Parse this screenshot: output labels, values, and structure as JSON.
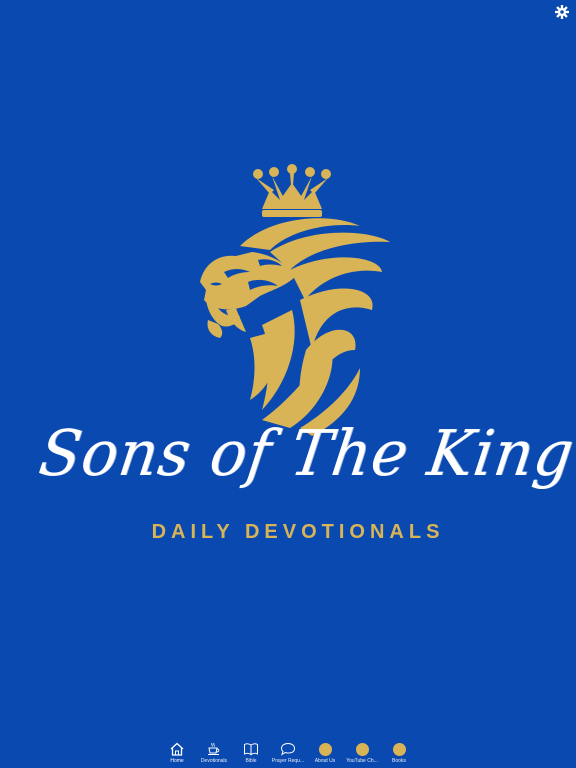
{
  "colors": {
    "background": "#0a4ab0",
    "gold": "#d8b456",
    "white": "#ffffff"
  },
  "header": {
    "settings_icon": "gear-icon"
  },
  "brand": {
    "title": "Sons of The King",
    "subtitle": "DAILY DEVOTIONALS"
  },
  "tabbar": {
    "tabs": [
      {
        "label": "Home",
        "icon": "home-icon",
        "active": true
      },
      {
        "label": "Devotionals",
        "icon": "cup-icon",
        "active": false
      },
      {
        "label": "Bible",
        "icon": "book-icon",
        "active": false
      },
      {
        "label": "Prayer Requ...",
        "icon": "speech-bubble-icon",
        "active": false
      },
      {
        "label": "About Us",
        "icon": "dot-icon",
        "active": false
      },
      {
        "label": "YouTube Ch...",
        "icon": "dot-icon",
        "active": false
      },
      {
        "label": "Books",
        "icon": "dot-icon",
        "active": false
      }
    ]
  }
}
